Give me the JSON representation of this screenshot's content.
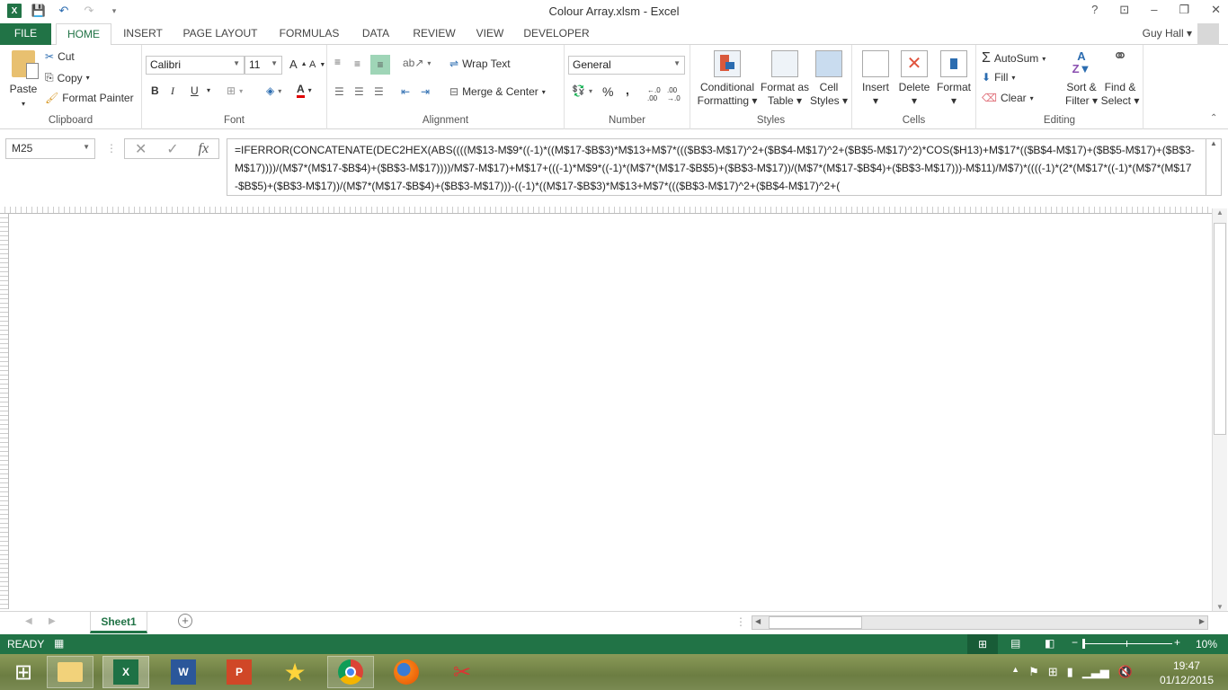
{
  "titlebar": {
    "title": "Colour Array.xlsm - Excel",
    "qat": {
      "save_icon": "save-icon",
      "undo_icon": "undo-icon",
      "redo_icon": "redo-icon",
      "customize_icon": "customize-qat-icon"
    },
    "help": "?",
    "ribbon_display": "ribbon-display-options-icon",
    "minimize": "–",
    "restore": "❐",
    "close": "✕"
  },
  "tabs": [
    {
      "label": "FILE"
    },
    {
      "label": "HOME"
    },
    {
      "label": "INSERT"
    },
    {
      "label": "PAGE LAYOUT"
    },
    {
      "label": "FORMULAS"
    },
    {
      "label": "DATA"
    },
    {
      "label": "REVIEW"
    },
    {
      "label": "VIEW"
    },
    {
      "label": "DEVELOPER"
    }
  ],
  "user": {
    "name": "Guy Hall"
  },
  "ribbon": {
    "clipboard": {
      "label": "Clipboard",
      "paste": "Paste",
      "cut": "Cut",
      "copy": "Copy",
      "format_painter": "Format Painter"
    },
    "font": {
      "label": "Font",
      "family": "Calibri",
      "size": "11",
      "bold": "B",
      "italic": "I",
      "underline": "U",
      "font_color": "#e00000"
    },
    "alignment": {
      "label": "Alignment",
      "wrap_text": "Wrap Text",
      "merge_center": "Merge & Center"
    },
    "number": {
      "label": "Number",
      "format": "General",
      "percent": "%",
      "comma": ","
    },
    "styles": {
      "label": "Styles",
      "conditional": [
        "Conditional",
        "Formatting"
      ],
      "format_table": [
        "Format as",
        "Table"
      ],
      "cell_styles": [
        "Cell",
        "Styles"
      ]
    },
    "cells": {
      "label": "Cells",
      "insert": "Insert",
      "delete": "Delete",
      "format": "Format"
    },
    "editing": {
      "label": "Editing",
      "autosum": "AutoSum",
      "fill": "Fill",
      "clear": "Clear",
      "sort_filter": [
        "Sort &",
        "Filter"
      ],
      "find_select": [
        "Find &",
        "Select"
      ]
    }
  },
  "formula_bar": {
    "name_box": "M25",
    "cancel": "✕",
    "enter": "✓",
    "fx": "fx",
    "formula": "=IFERROR(CONCATENATE(DEC2HEX(ABS((((M$13-M$9*((-1)*((M$17-$B$3)*M$13+M$7*((($B$3-M$17)^2+($B$4-M$17)^2+($B$5-M$17)^2)*COS($H13)+M$17*(($B$4-M$17)+($B$5-M$17)+($B$3-M$17))))/(M$7*(M$17-$B$4)+($B$3-M$17))))/M$7-M$17)+M$17+(((-1)*M$9*((-1)*(M$7*(M$17-$B$5)+($B$3-M$17))/(M$7*(M$17-$B$4)+($B$3-M$17)))-M$11)/M$7)*((((-1)*(2*(M$17*((-1)*(M$7*(M$17-$B$5)+($B$3-M$17))/(M$7*(M$17-$B$4)+($B$3-M$17)))-((-1)*((M$17-$B$3)*M$13+M$7*((($B$3-M$17)^2+($B$4-M$17)^2+("
  },
  "sheets": {
    "tabs": [
      {
        "label": "Sheet1",
        "active": true
      }
    ],
    "add": "+"
  },
  "status": {
    "ready": "READY",
    "zoom": "10%",
    "zoom_fraction": 0.1
  },
  "taskbar": {
    "apps": [
      "start",
      "file-explorer",
      "excel",
      "word",
      "powerpoint",
      "favorites",
      "chrome",
      "firefox",
      "snipping-tool"
    ],
    "time": "19:47",
    "date": "01/12/2015"
  }
}
